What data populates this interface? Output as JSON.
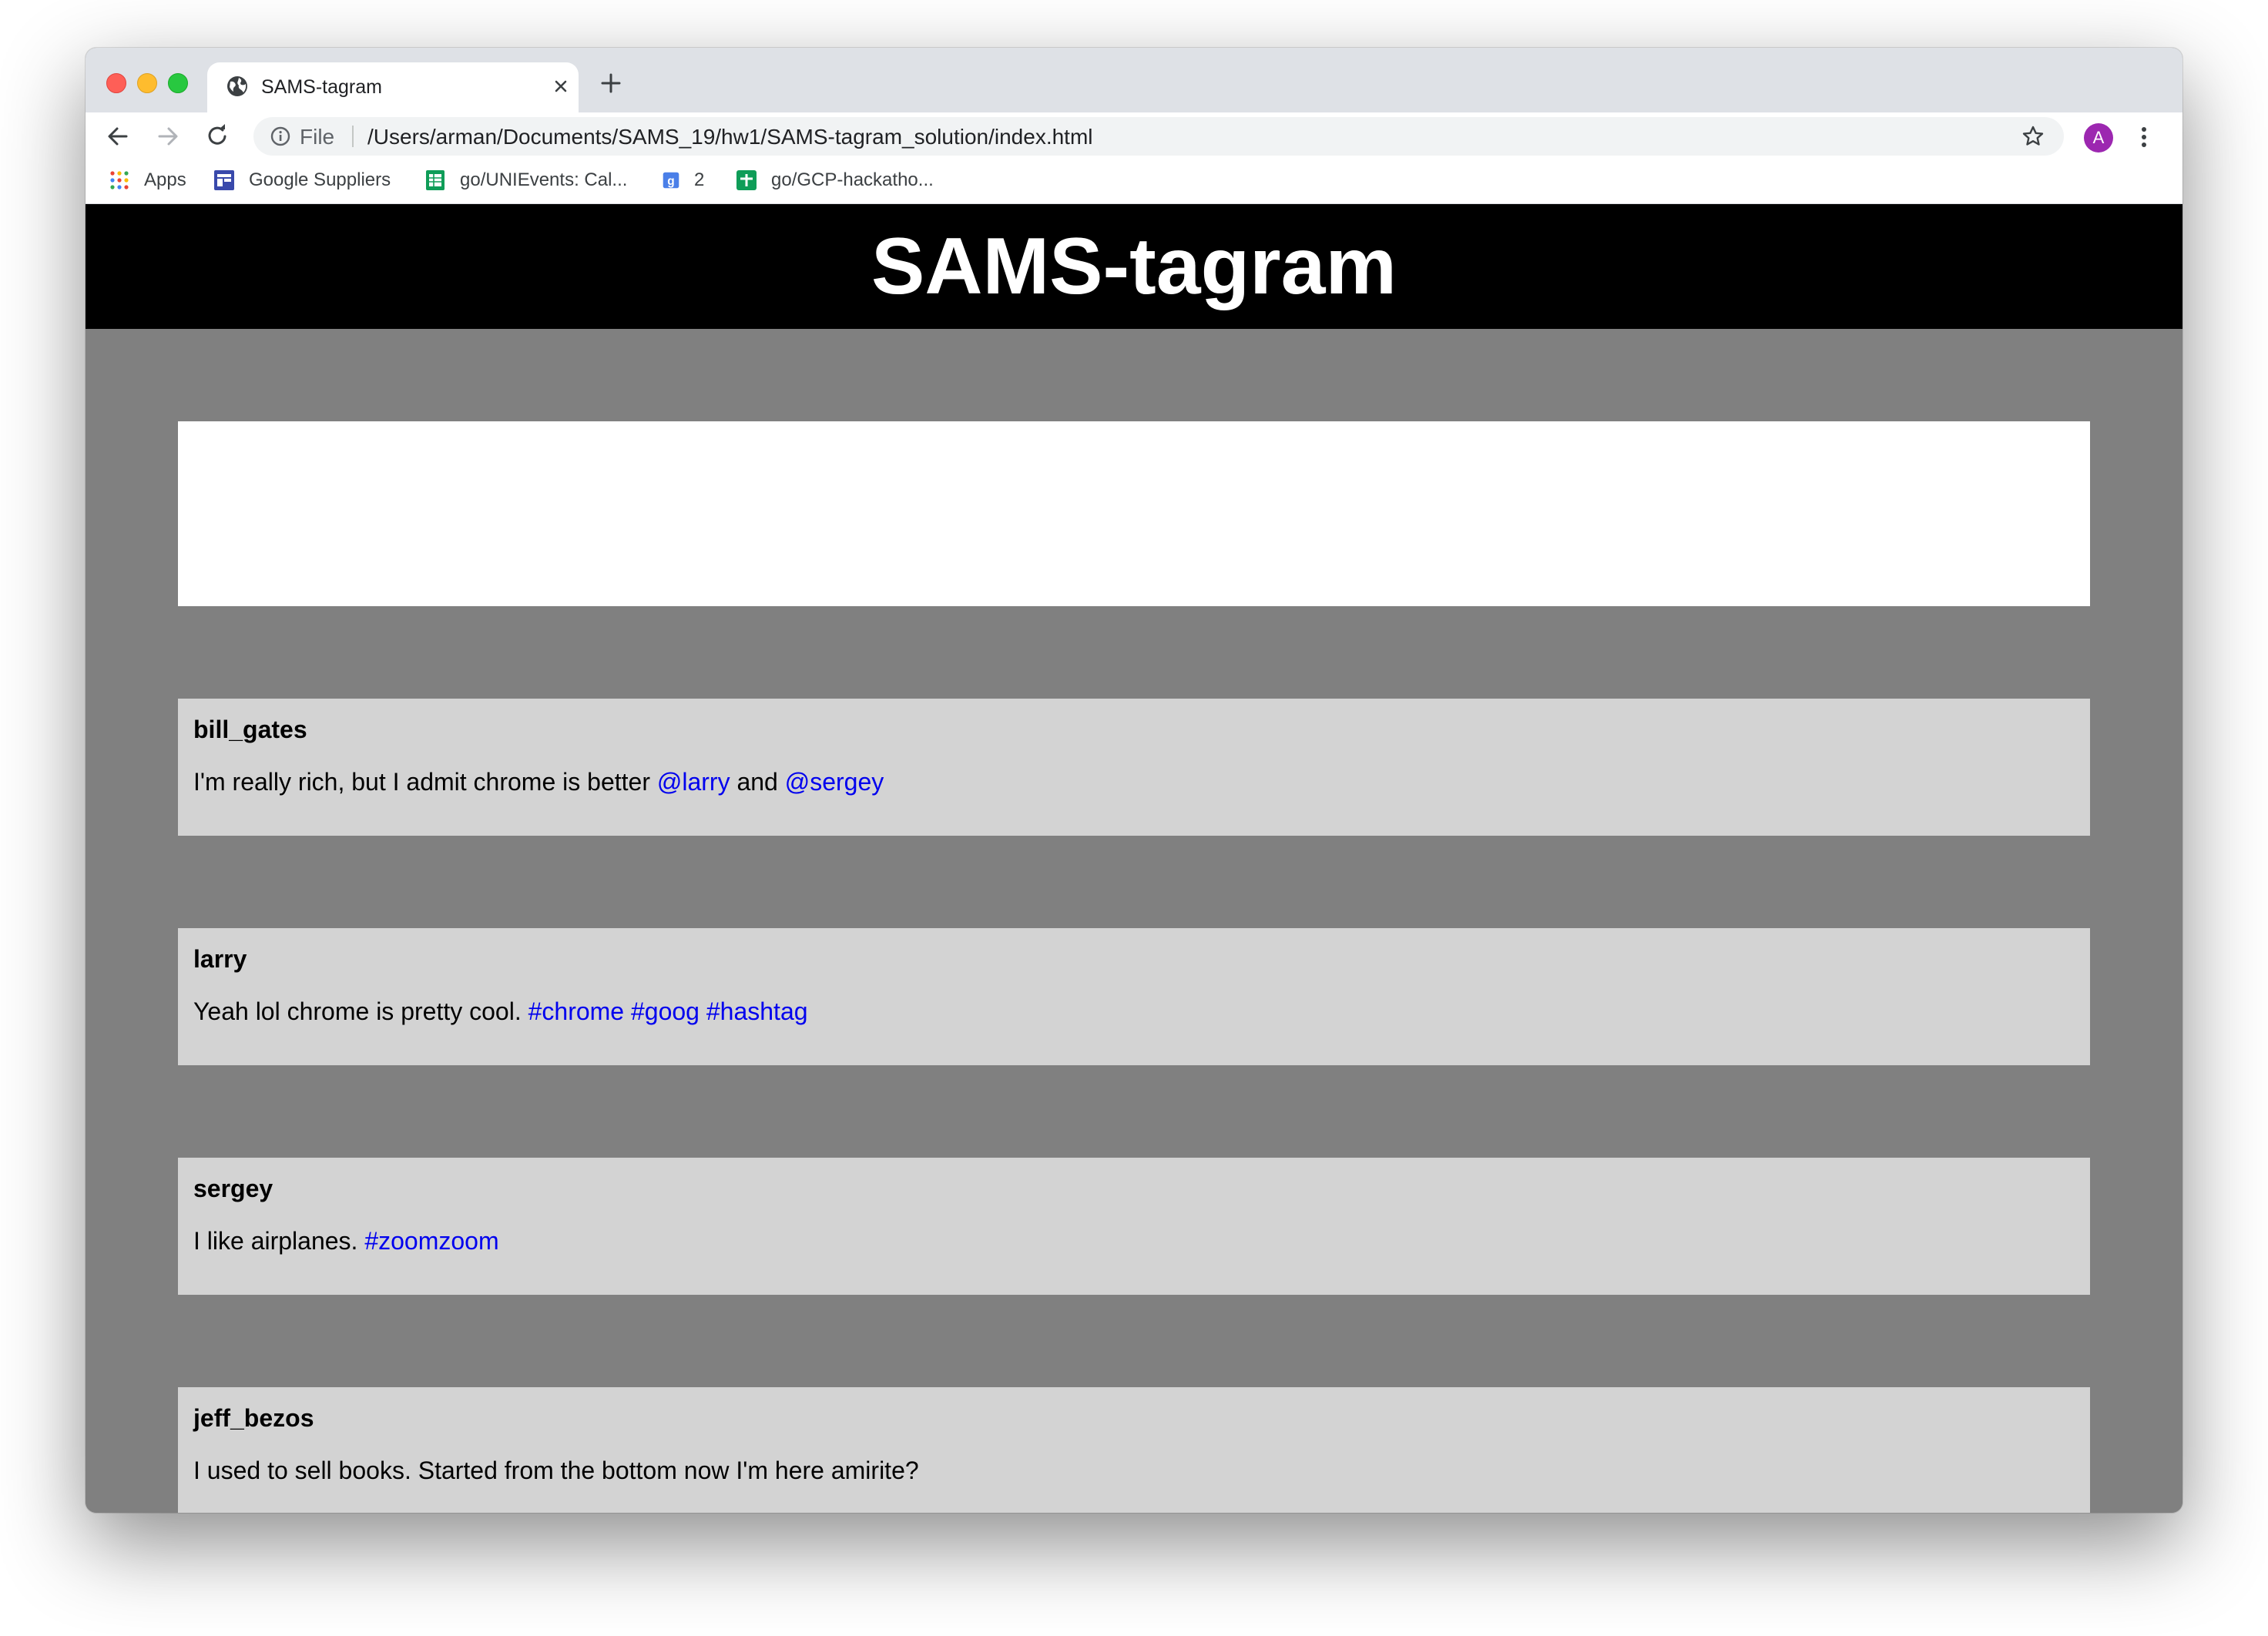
{
  "browser": {
    "tab": {
      "title": "SAMS-tagram"
    },
    "omnibox": {
      "scheme_label": "File",
      "url": "/Users/arman/Documents/SAMS_19/hw1/SAMS-tagram_solution/index.html"
    },
    "profile_initial": "A",
    "bookmarks": [
      {
        "label": "Apps",
        "icon": "apps-grid-icon"
      },
      {
        "label": "Google Suppliers",
        "icon": "suppliers-icon"
      },
      {
        "label": "go/UNIEvents: Cal...",
        "icon": "sheets-icon"
      },
      {
        "label": "2",
        "icon": "google-doc-icon"
      },
      {
        "label": "go/GCP-hackatho...",
        "icon": "sheets-plus-icon"
      }
    ]
  },
  "page": {
    "title": "SAMS-tagram",
    "link_color": "#0000ee",
    "posts": [
      {
        "user": "bill_gates",
        "parts": [
          {
            "text": "I'm really rich, but I admit chrome is better "
          },
          {
            "text": "@larry",
            "link": true
          },
          {
            "text": " and "
          },
          {
            "text": "@sergey",
            "link": true
          }
        ]
      },
      {
        "user": "larry",
        "parts": [
          {
            "text": "Yeah lol chrome is pretty cool. "
          },
          {
            "text": "#chrome",
            "link": true
          },
          {
            "text": " "
          },
          {
            "text": "#goog",
            "link": true
          },
          {
            "text": " "
          },
          {
            "text": "#hashtag",
            "link": true
          }
        ]
      },
      {
        "user": "sergey",
        "parts": [
          {
            "text": "I like airplanes. "
          },
          {
            "text": "#zoomzoom",
            "link": true
          }
        ]
      },
      {
        "user": "jeff_bezos",
        "parts": [
          {
            "text": "I used to sell books. Started from the bottom now I'm here amirite?"
          }
        ]
      }
    ]
  }
}
